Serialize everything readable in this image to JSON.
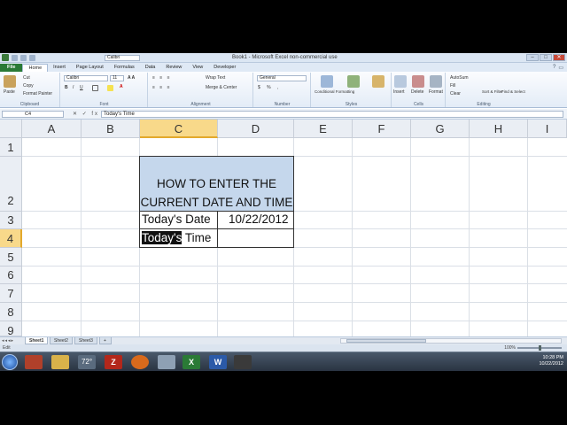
{
  "window": {
    "title": "Book1 - Microsoft Excel non-commercial use",
    "font_name_top": "Calibri",
    "controls": [
      "–",
      "□",
      "✕"
    ]
  },
  "ribbon_tabs": [
    "File",
    "Home",
    "Insert",
    "Page Layout",
    "Formulas",
    "Data",
    "Review",
    "View",
    "Developer"
  ],
  "ribbon": {
    "clipboard": {
      "paste": "Paste",
      "cut": "Cut",
      "copy": "Copy",
      "format_painter": "Format Painter",
      "label": "Clipboard"
    },
    "font": {
      "name": "Calibri",
      "size": "11",
      "label": "Font"
    },
    "alignment": {
      "wrap": "Wrap Text",
      "merge": "Merge & Center",
      "label": "Alignment"
    },
    "number": {
      "format": "General",
      "label": "Number"
    },
    "styles": {
      "conditional": "Conditional Formatting",
      "format_table": "Format as Table",
      "cell_styles": "Cell Styles",
      "label": "Styles"
    },
    "cells": {
      "insert": "Insert",
      "delete": "Delete",
      "format": "Format",
      "label": "Cells"
    },
    "editing": {
      "autosum": "AutoSum",
      "fill": "Fill",
      "clear": "Clear",
      "sort": "Sort & Filter",
      "find": "Find & Select",
      "label": "Editing"
    }
  },
  "formula_bar": {
    "name_box": "C4",
    "buttons": "✕ ✓ fx",
    "value": "Today's Time"
  },
  "columns": [
    "A",
    "B",
    "C",
    "D",
    "E",
    "F",
    "G",
    "H",
    "I"
  ],
  "rows": [
    "1",
    "2",
    "3",
    "4",
    "5",
    "6",
    "7",
    "8",
    "9"
  ],
  "cells": {
    "title_line1": "HOW TO ENTER THE",
    "title_line2": "CURRENT DATE AND TIME",
    "c3": "Today's Date",
    "d3": "10/22/2012",
    "c4_selected": "Today's",
    "c4_rest": " Time"
  },
  "sheets": [
    "Sheet1",
    "Sheet2",
    "Sheet3"
  ],
  "status": {
    "mode": "Edit",
    "zoom": "100%"
  },
  "taskbar": {
    "items": [
      "72°",
      "FileZilla",
      "Firefox",
      "Calculator",
      "Excel",
      "Word",
      "Camera"
    ],
    "time": "10:28 PM",
    "date": "10/22/2012"
  }
}
